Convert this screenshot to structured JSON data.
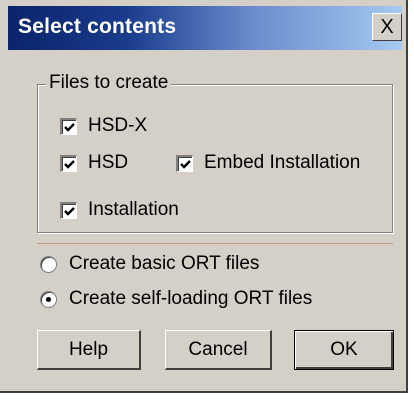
{
  "window": {
    "title": "Select contents",
    "close_glyph": "X"
  },
  "group": {
    "legend": "Files to create",
    "checkboxes": [
      {
        "label": "HSD-X",
        "checked": true
      },
      {
        "label": "HSD",
        "checked": true
      },
      {
        "label": "Embed Installation",
        "checked": true
      },
      {
        "label": "Installation",
        "checked": true
      }
    ]
  },
  "options": {
    "radios": [
      {
        "label": "Create basic ORT files",
        "selected": false
      },
      {
        "label": "Create self-loading ORT files",
        "selected": true
      }
    ]
  },
  "buttons": {
    "help": "Help",
    "cancel": "Cancel",
    "ok": "OK"
  },
  "colors": {
    "dialog_bg": "#d4d0c8",
    "title_start": "#0a246a",
    "title_end": "#a6caf0"
  },
  "icons": {
    "close": "close-icon",
    "check": "checkmark-icon"
  }
}
